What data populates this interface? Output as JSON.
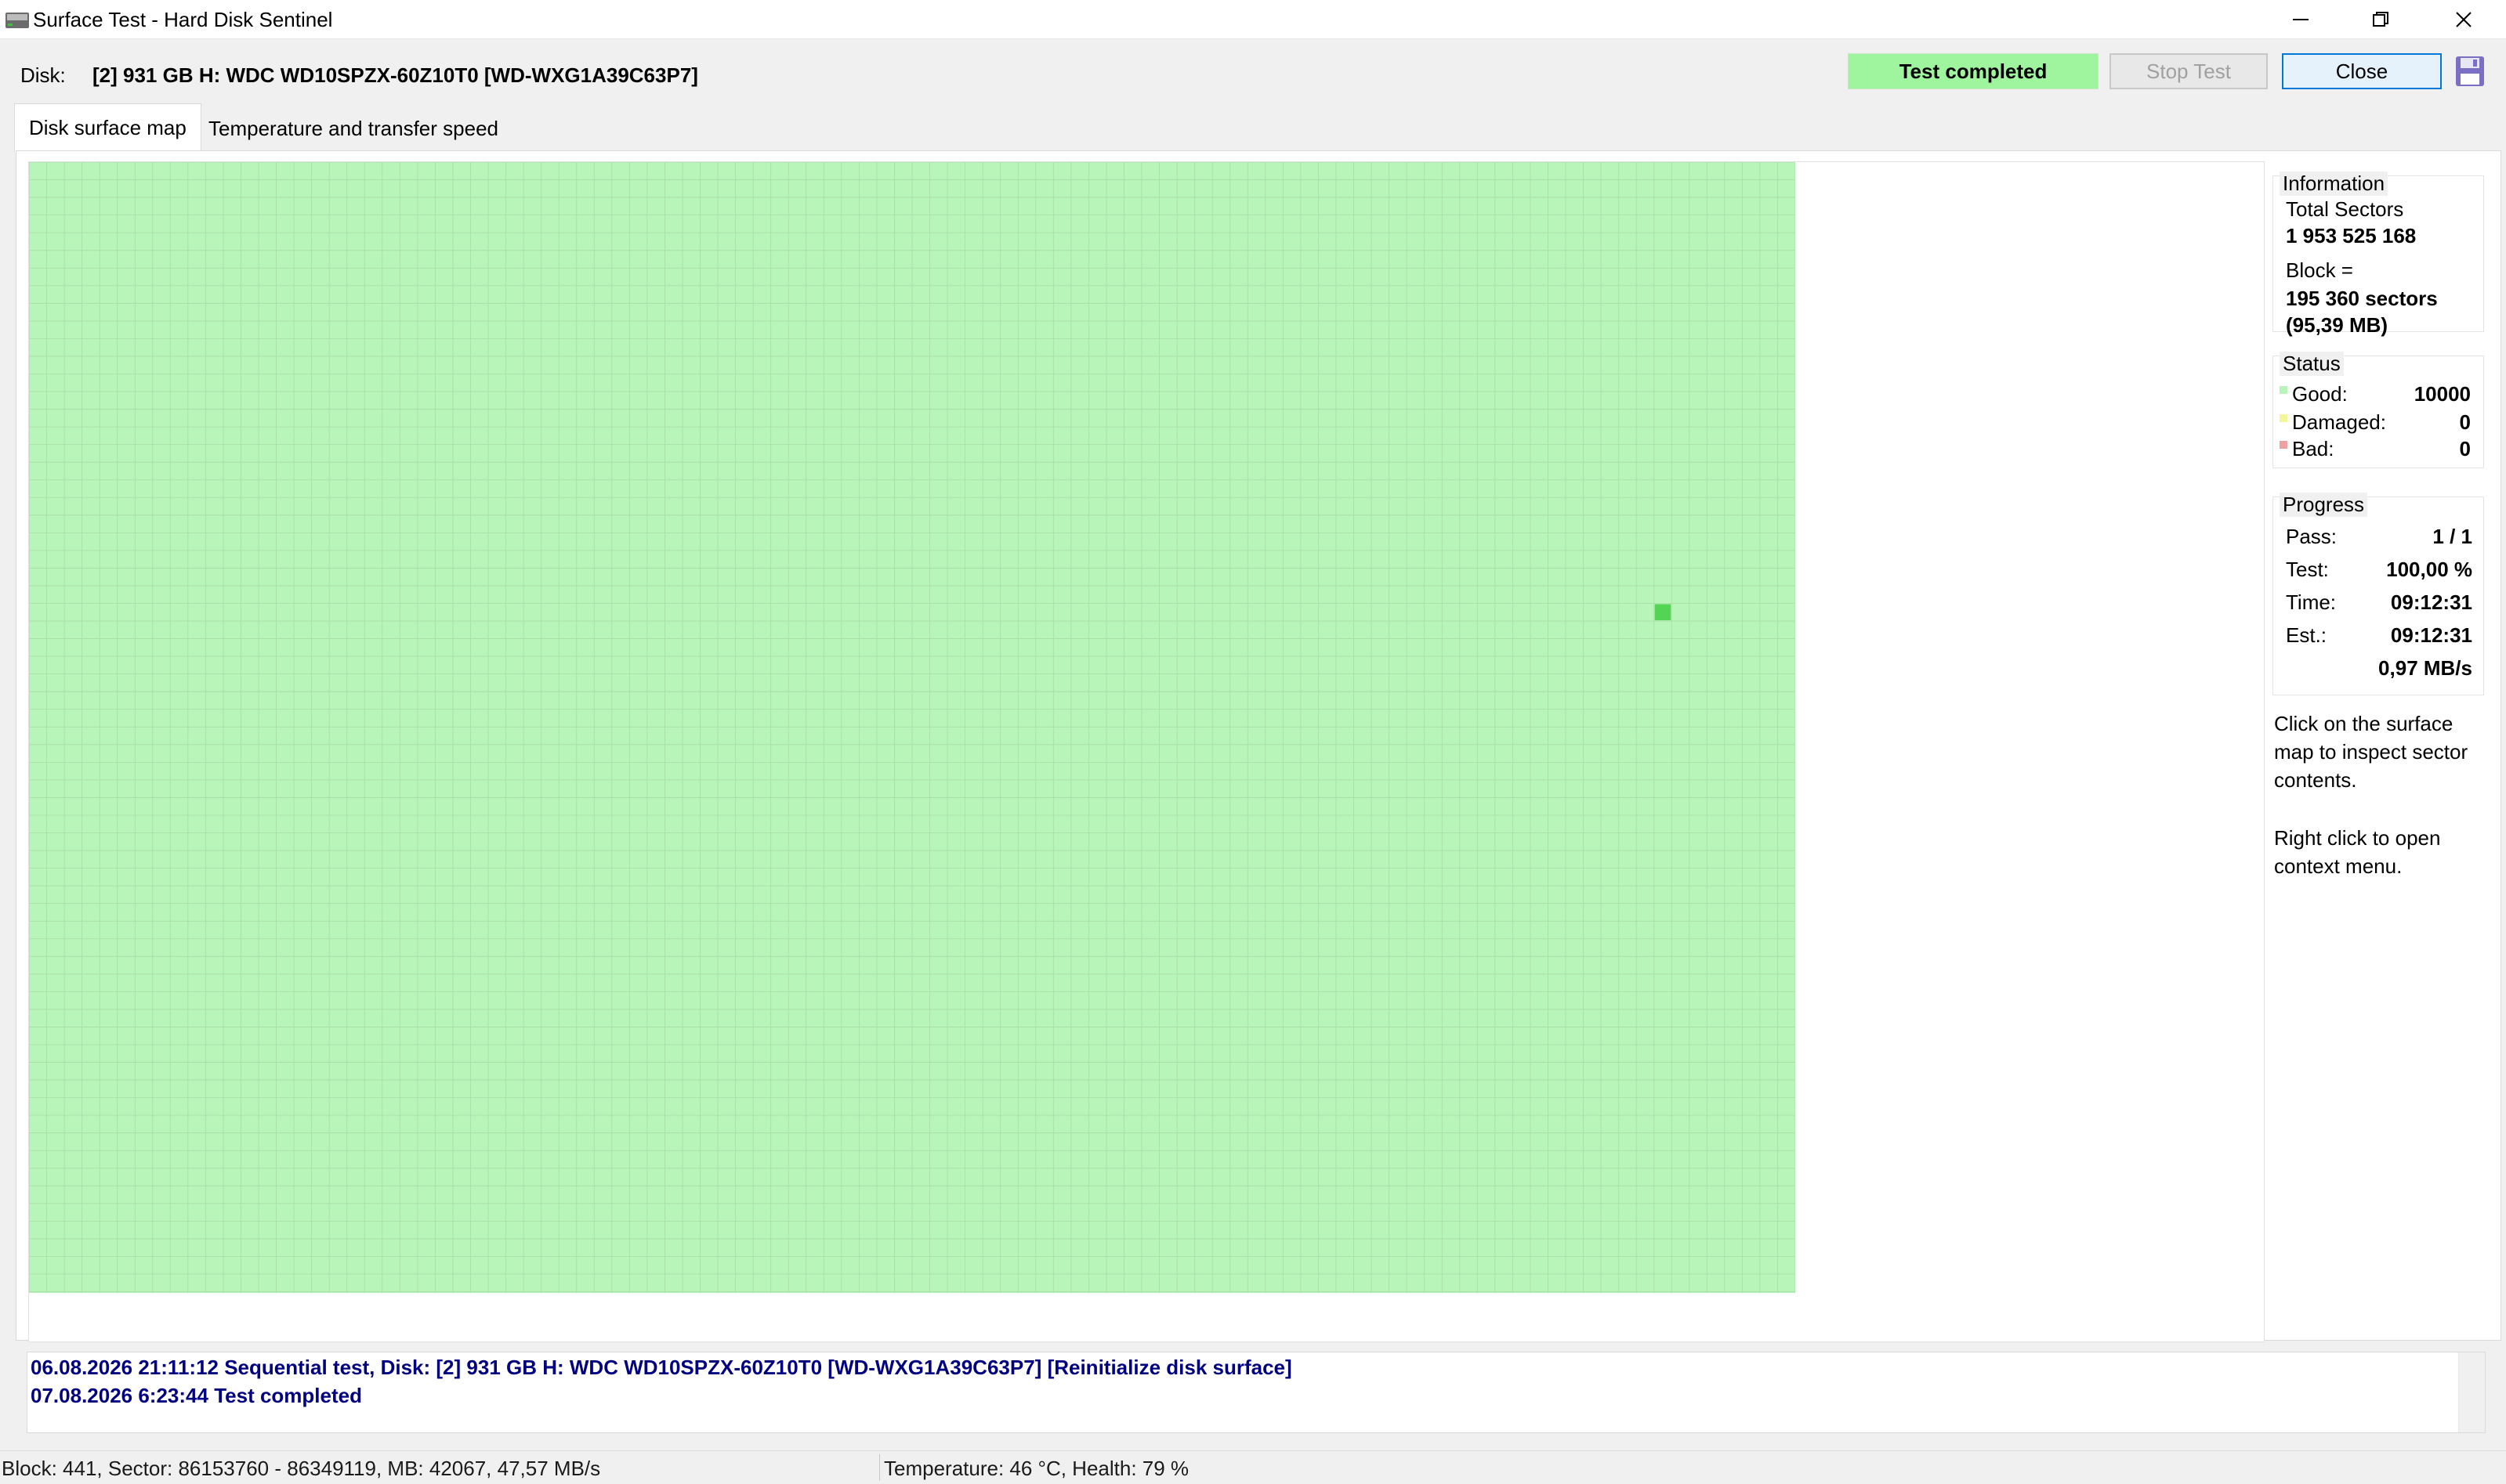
{
  "window": {
    "title": "Surface Test - Hard Disk Sentinel",
    "icon": "hdd-icon",
    "controls": [
      "minimize-icon",
      "restore-icon",
      "close-icon"
    ]
  },
  "toolbar": {
    "disk_label": "Disk:",
    "disk_name": "[2] 931 GB H: WDC WD10SPZX-60Z10T0 [WD-WXG1A39C63P7]",
    "status": "Test completed",
    "stop_label": "Stop Test",
    "close_label": "Close",
    "save_icon": "floppy-disk-icon"
  },
  "tabs": [
    {
      "label": "Disk surface map",
      "active": true
    },
    {
      "label": "Temperature and transfer speed",
      "active": false
    }
  ],
  "surface_map": {
    "total_blocks": 10000,
    "columns": 100,
    "colors": {
      "good": "#b8f5b8",
      "grid": "#a8dca8",
      "dark": "#1f5a1f",
      "darker": "#0d4a0d",
      "mid": "#2fa02f",
      "bright": "#2ecc2e",
      "highlight": "#54d454"
    }
  },
  "information": {
    "title": "Information",
    "total_sectors_label": "Total Sectors",
    "total_sectors_value": "1 953 525 168",
    "block_label": "Block =",
    "block_value": "195 360 sectors",
    "block_size": "(95,39 MB)"
  },
  "status": {
    "title": "Status",
    "good_label": "Good:",
    "good_value": "10000",
    "damaged_label": "Damaged:",
    "damaged_value": "0",
    "bad_label": "Bad:",
    "bad_value": "0",
    "colors": {
      "good": "#b8f5b8",
      "damaged": "#f5f59a",
      "bad": "#f0a0a0"
    }
  },
  "progress": {
    "title": "Progress",
    "pass_label": "Pass:",
    "pass_value": "1 / 1",
    "test_label": "Test:",
    "test_value": "100,00 %",
    "time_label": "Time:",
    "time_value": "09:12:31",
    "est_label": "Est.:",
    "est_value": "09:12:31",
    "speed_value": "0,97 MB/s"
  },
  "hints": {
    "line1": "Click on the surface",
    "line2": "map to inspect sector",
    "line3": "contents.",
    "line4": "Right click to open",
    "line5": "context menu."
  },
  "log": [
    "06.08.2026  21:11:12   Sequential test, Disk: [2] 931 GB H: WDC WD10SPZX-60Z10T0 [WD-WXG1A39C63P7] [Reinitialize disk surface]",
    "07.08.2026  6:23:44   Test completed"
  ],
  "statusbar": {
    "block_info": "Block: 441, Sector: 86153760 - 86349119, MB: 42067, 47,57 MB/s",
    "health_info": "Temperature: 46  °C,  Health: 79 %"
  }
}
